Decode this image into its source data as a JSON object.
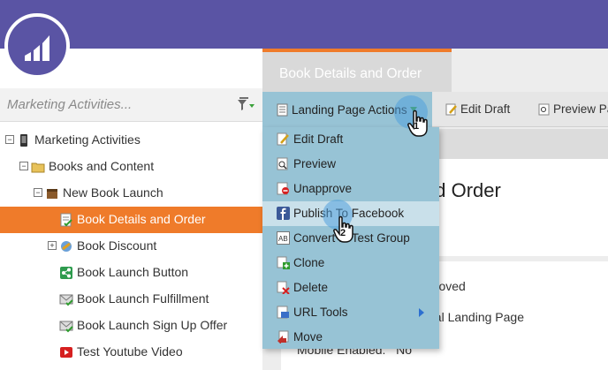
{
  "sidebar": {
    "search_placeholder": "Marketing Activities...",
    "tree": [
      {
        "label": "Marketing Activities",
        "icon": "phone-icon"
      },
      {
        "label": "Books and Content",
        "icon": "folder-icon"
      },
      {
        "label": "New Book Launch",
        "icon": "program-icon"
      },
      {
        "label": "Book Details and Order",
        "icon": "landing-page-approved-icon"
      },
      {
        "label": "Book Discount",
        "icon": "program-icon"
      },
      {
        "label": "Book Launch Button",
        "icon": "share-icon"
      },
      {
        "label": "Book Launch Fulfillment",
        "icon": "email-approved-icon"
      },
      {
        "label": "Book Launch Sign Up Offer",
        "icon": "email-approved-icon"
      },
      {
        "label": "Test Youtube Video",
        "icon": "youtube-icon"
      }
    ]
  },
  "tab": {
    "label": "Book Details and Order"
  },
  "toolbar": {
    "actions_label": "Landing Page Actions",
    "edit_draft_label": "Edit Draft",
    "preview_label": "Preview Pa"
  },
  "menu": {
    "items": [
      {
        "label": "Edit Draft",
        "icon": "edit-icon"
      },
      {
        "label": "Preview",
        "icon": "preview-icon"
      },
      {
        "label": "Unapprove",
        "icon": "unapprove-icon"
      },
      {
        "label": "Publish To Facebook",
        "icon": "facebook-icon"
      },
      {
        "label": "Convert to Test Group",
        "icon": "ab-test-icon"
      },
      {
        "label": "Clone",
        "icon": "clone-icon"
      },
      {
        "label": "Delete",
        "icon": "delete-icon"
      },
      {
        "label": "URL Tools",
        "icon": "url-tools-icon"
      },
      {
        "label": "Move",
        "icon": "move-icon"
      }
    ]
  },
  "main": {
    "page_title": "nd Order",
    "detail_1": "proved",
    "detail_2": "ual Landing Page",
    "detail_3_label": "Mobile Enabled:",
    "detail_3_value": "No"
  },
  "steps": {
    "one": "1",
    "two": "2"
  },
  "colors": {
    "brand_purple": "#5a54a4",
    "selected_orange": "#ef7b2a",
    "menu_blue": "#97c3d5"
  }
}
